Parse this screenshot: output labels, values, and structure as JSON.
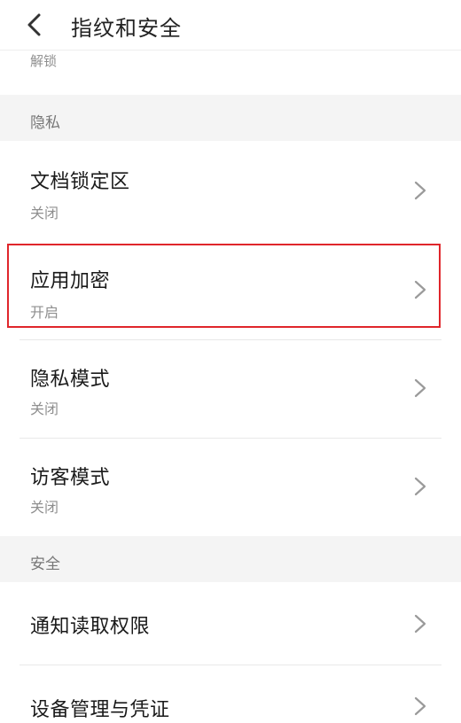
{
  "header": {
    "title": "指纹和安全"
  },
  "partial_item": {
    "subtitle": "解锁"
  },
  "sections": [
    {
      "label": "隐私",
      "items": [
        {
          "title": "文档锁定区",
          "subtitle": "关闭"
        },
        {
          "title": "应用加密",
          "subtitle": "开启"
        },
        {
          "title": "隐私模式",
          "subtitle": "关闭"
        },
        {
          "title": "访客模式",
          "subtitle": "关闭"
        }
      ]
    },
    {
      "label": "安全",
      "items": [
        {
          "title": "通知读取权限"
        },
        {
          "title": "设备管理与凭证"
        }
      ]
    }
  ],
  "colors": {
    "highlight": "#e0262b",
    "section_bg": "#f4f4f4"
  },
  "icons": {
    "back": "chevron-left-icon",
    "row": "chevron-right-icon"
  }
}
